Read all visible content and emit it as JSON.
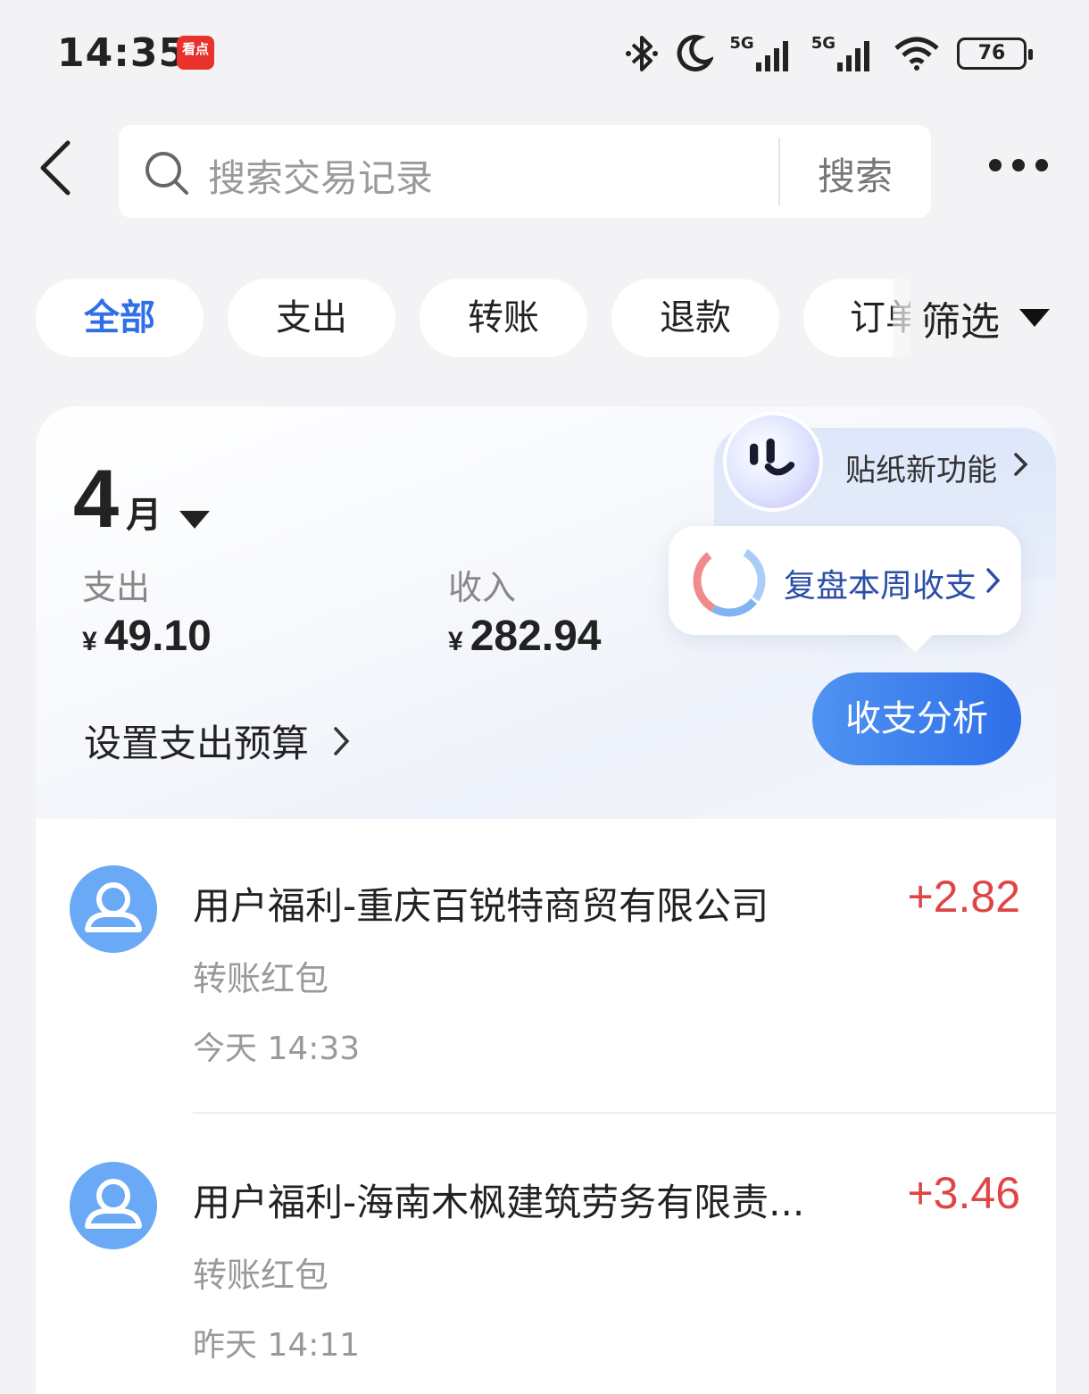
{
  "status_bar": {
    "time": "14:35",
    "app_badge": "看点",
    "network_1": "5G",
    "network_2": "5G",
    "battery": "76",
    "icons": [
      "bluetooth-icon",
      "moon-icon",
      "signal-icon",
      "wifi-icon",
      "battery-icon"
    ]
  },
  "header": {
    "search_placeholder": "搜索交易记录",
    "search_button": "搜索"
  },
  "tabs": [
    {
      "label": "全部",
      "active": true
    },
    {
      "label": "支出",
      "active": false
    },
    {
      "label": "转账",
      "active": false
    },
    {
      "label": "退款",
      "active": false
    },
    {
      "label": "订单",
      "active": false
    }
  ],
  "filter_label": "筛选",
  "summary": {
    "month_number": "4",
    "month_unit": "月",
    "expense_label": "支出",
    "expense_currency": "¥",
    "expense_value": "49.10",
    "income_label": "收入",
    "income_currency": "¥",
    "income_value": "282.94",
    "budget_link": "设置支出预算",
    "sticker_promo": "贴纸新功能",
    "review_link": "复盘本周收支",
    "analysis_button": "收支分析"
  },
  "transactions": [
    {
      "name": "用户福利-重庆百锐特商贸有限公司",
      "amount": "+2.82",
      "category": "转账红包",
      "time": "今天 14:33"
    },
    {
      "name": "用户福利-海南木枫建筑劳务有限责...",
      "amount": "+3.46",
      "category": "转账红包",
      "time": "昨天 14:11"
    }
  ],
  "colors": {
    "accent_blue": "#2f6fe8",
    "income_red": "#e04545",
    "background": "#f3f3f5"
  }
}
